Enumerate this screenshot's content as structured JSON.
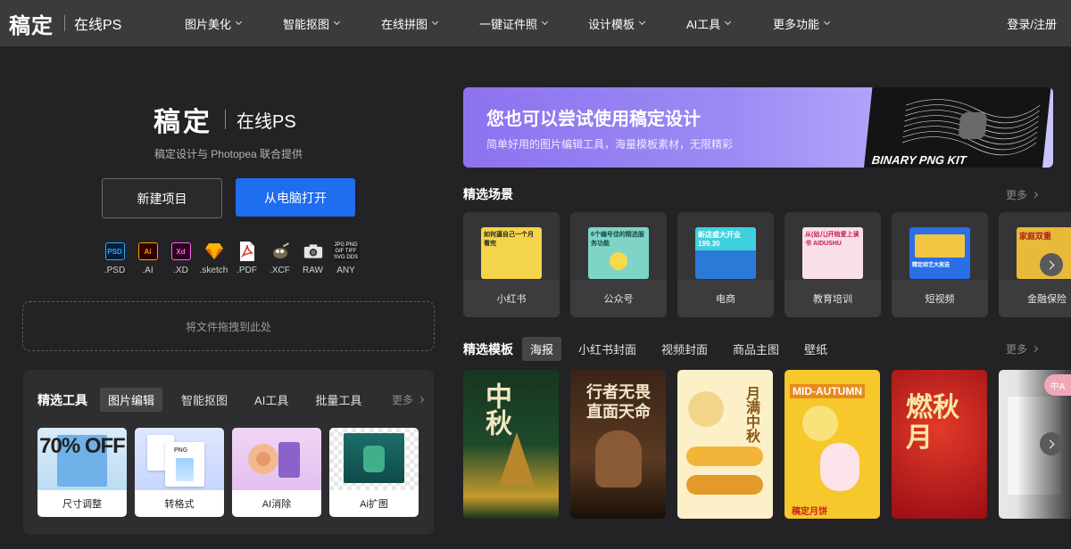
{
  "nav": {
    "logo_main": "稿定",
    "logo_sub": "在线PS",
    "items": [
      "图片美化",
      "智能抠图",
      "在线拼图",
      "一键证件照",
      "设计模板",
      "AI工具",
      "更多功能"
    ],
    "login": "登录/注册"
  },
  "hero": {
    "brand_main": "稿定",
    "brand_sub": "在线PS",
    "caption": "稿定设计与 Photopea 联合提供",
    "new_project": "新建项目",
    "open_from_pc": "从电脑打开",
    "dropzone": "将文件拖拽到此处"
  },
  "formats": [
    {
      "label": ".PSD",
      "icon": "psd-icon",
      "text": "PSD",
      "color": "#31a8ff"
    },
    {
      "label": ".AI",
      "icon": "ai-icon",
      "text": "Ai",
      "color": "#ff9a00"
    },
    {
      "label": ".XD",
      "icon": "xd-icon",
      "text": "Xd",
      "color": "#ff61f6"
    },
    {
      "label": ".sketch",
      "icon": "sketch-icon",
      "text": "",
      "color": "#f7b500"
    },
    {
      "label": ".PDF",
      "icon": "pdf-icon",
      "text": "",
      "color": "#e8392b"
    },
    {
      "label": ".XCF",
      "icon": "gimp-icon",
      "text": "",
      "color": "#8c8c8c"
    },
    {
      "label": "RAW",
      "icon": "camera-icon",
      "text": "",
      "color": "#dcdcdc"
    },
    {
      "label": "ANY",
      "icon": "any-format-icon",
      "text": "JPG PNG GIF TIFF SVG DDS",
      "color": "#ffffff"
    }
  ],
  "tools": {
    "title": "精选工具",
    "tabs": [
      "图片编辑",
      "智能抠图",
      "AI工具",
      "批量工具"
    ],
    "more": "更多",
    "cards": [
      {
        "label": "尺寸调整",
        "art": "70% OFF"
      },
      {
        "label": "转格式",
        "art": "PNG"
      },
      {
        "label": "AI消除",
        "art": ""
      },
      {
        "label": "Ai扩图",
        "art": ""
      }
    ]
  },
  "banner": {
    "title": "您也可以尝试使用稿定设计",
    "subtitle": "简单好用的图片编辑工具，海量模板素材，无限精彩",
    "art_text": "BINARY PNG KIT"
  },
  "scenes": {
    "title": "精选场景",
    "more": "更多",
    "items": [
      {
        "label": "小红书",
        "thumb_text": "如何逼自己一个月看完",
        "bg": "#f4d44a"
      },
      {
        "label": "公众号",
        "thumb_text": "6个编号佳的精选服务功能",
        "bg": "#7fd4c8"
      },
      {
        "label": "电商",
        "thumb_text": "新店盛大开业 199.30",
        "bg": "#2a7bd8"
      },
      {
        "label": "教育培训",
        "thumb_text": "从(幼儿)开始爱上读书 AIDUSHU",
        "bg": "#f9e0e6"
      },
      {
        "label": "短视频",
        "thumb_text": "精定综艺大放送",
        "bg": "#2b6fe6"
      },
      {
        "label": "金融保险",
        "thumb_text": "家庭双重",
        "bg": "#e9b93a"
      }
    ]
  },
  "templates": {
    "title": "精选模板",
    "tabs": [
      "海报",
      "小红书封面",
      "视频封面",
      "商品主图",
      "壁纸"
    ],
    "more": "更多",
    "items": [
      {
        "name": "mid-autumn-poster",
        "text": "中秋",
        "bg": "#16331f"
      },
      {
        "name": "wukong-poster",
        "text": "行者无畏 直面天命",
        "bg": "#2a1a12"
      },
      {
        "name": "mooncake-poster",
        "text": "月满中秋",
        "bg": "#fbf0c8"
      },
      {
        "name": "autumn-festival-poster",
        "text": "MID-AUTUMN",
        "bg": "#f7c82b"
      },
      {
        "name": "red-mooncake-poster",
        "text": "燃秋月",
        "bg": "#b3121a"
      },
      {
        "name": "teacher-poster",
        "text": "",
        "bg": "#e8e8e8"
      }
    ]
  },
  "side_pill": "中A"
}
